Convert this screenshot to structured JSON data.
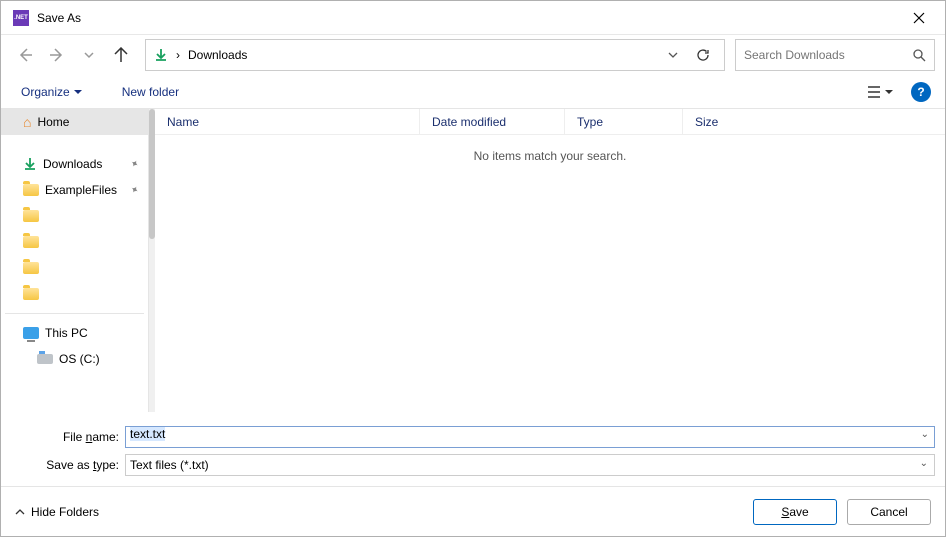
{
  "title": "Save As",
  "nav": {
    "location_icon": "download",
    "crumb_sep": "›",
    "crumb": "Downloads"
  },
  "search": {
    "placeholder": "Search Downloads"
  },
  "toolbar": {
    "organize": "Organize",
    "new_folder": "New folder"
  },
  "sidebar": {
    "home": "Home",
    "downloads": "Downloads",
    "examplefiles": "ExampleFiles",
    "thispc": "This PC",
    "osc": "OS (C:)"
  },
  "columns": {
    "name": "Name",
    "date": "Date modified",
    "type": "Type",
    "size": "Size"
  },
  "empty": "No items match your search.",
  "form": {
    "filename_label_pre": "File ",
    "filename_label_u": "n",
    "filename_label_post": "ame:",
    "filename_value": "text.txt",
    "type_label_pre": "Save as ",
    "type_label_u": "t",
    "type_label_post": "ype:",
    "type_value": "Text files (*.txt)"
  },
  "footer": {
    "hide": "Hide Folders",
    "save_u": "S",
    "save_rest": "ave",
    "cancel": "Cancel"
  }
}
